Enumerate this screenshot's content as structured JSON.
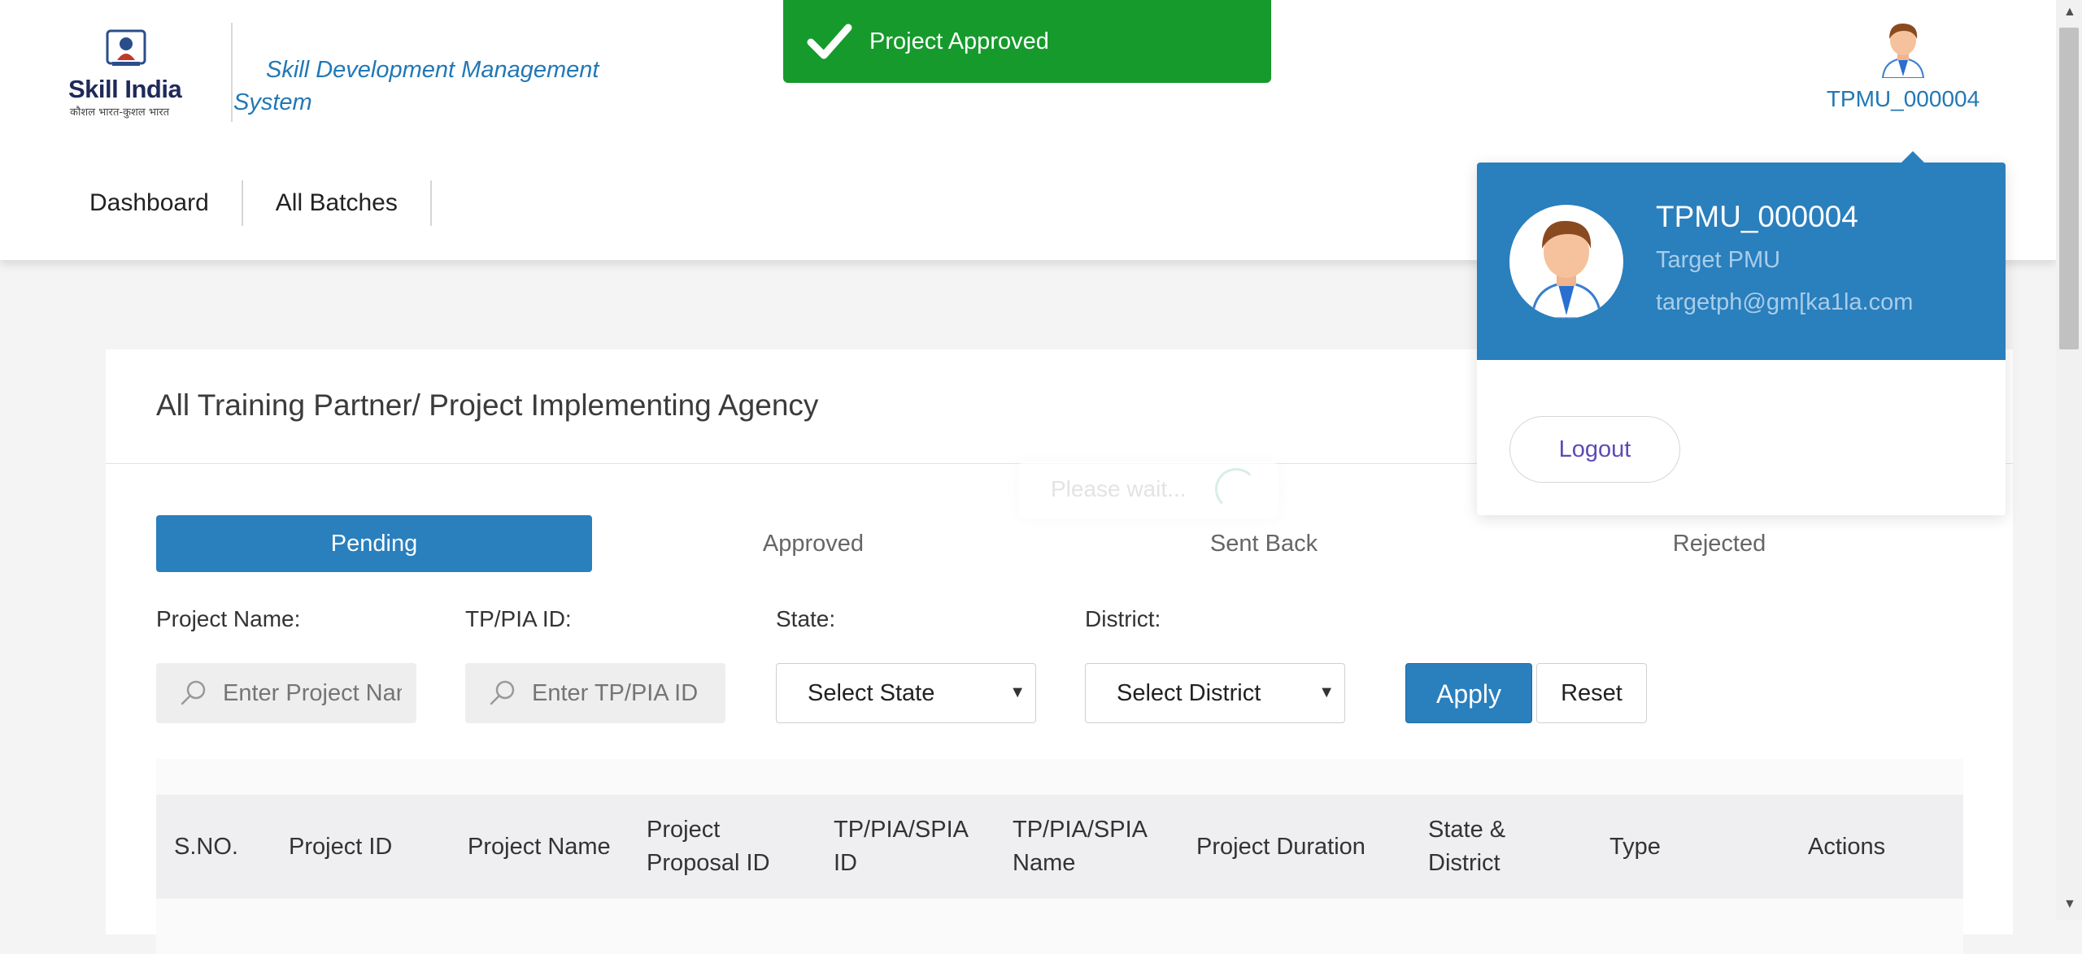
{
  "app": {
    "logo_brand": "Skill India",
    "logo_tagline": "कौशल भारत-कुशल भारत",
    "title": "Skill Development Management System"
  },
  "nav": {
    "items": [
      {
        "label": "Dashboard"
      },
      {
        "label": "All Batches"
      }
    ]
  },
  "user": {
    "username": "TPMU_000004",
    "role": "Target PMU",
    "email": "targetph@gm[ka1la.com",
    "logout_label": "Logout"
  },
  "toast": {
    "message": "Project Approved",
    "color": "#169a2c",
    "icon": "check-icon"
  },
  "page": {
    "title": "All Training Partner/ Project Implementing Agency",
    "tabs": [
      {
        "label": "Pending",
        "active": true
      },
      {
        "label": "Approved",
        "active": false
      },
      {
        "label": "Sent Back",
        "active": false
      },
      {
        "label": "Rejected",
        "active": false
      }
    ]
  },
  "filters": {
    "project_name": {
      "label": "Project Name:",
      "placeholder": "Enter Project Name",
      "icon": "search-icon"
    },
    "tp_pia_id": {
      "label": "TP/PIA ID:",
      "placeholder": "Enter TP/PIA ID",
      "icon": "search-icon"
    },
    "state": {
      "label": "State:",
      "selected": "Select State"
    },
    "district": {
      "label": "District:",
      "selected": "Select District"
    },
    "apply_label": "Apply",
    "reset_label": "Reset"
  },
  "table": {
    "columns": [
      "S.NO.",
      "Project ID",
      "Project Name",
      "Project Proposal ID",
      "TP/PIA/SPIA ID",
      "TP/PIA/SPIA Name",
      "Project Duration",
      "State & District",
      "Type",
      "Actions"
    ]
  },
  "loading": {
    "text": "Please wait..."
  },
  "colors": {
    "primary": "#2a7fbd",
    "link": "#2278b5",
    "success": "#169a2c"
  }
}
